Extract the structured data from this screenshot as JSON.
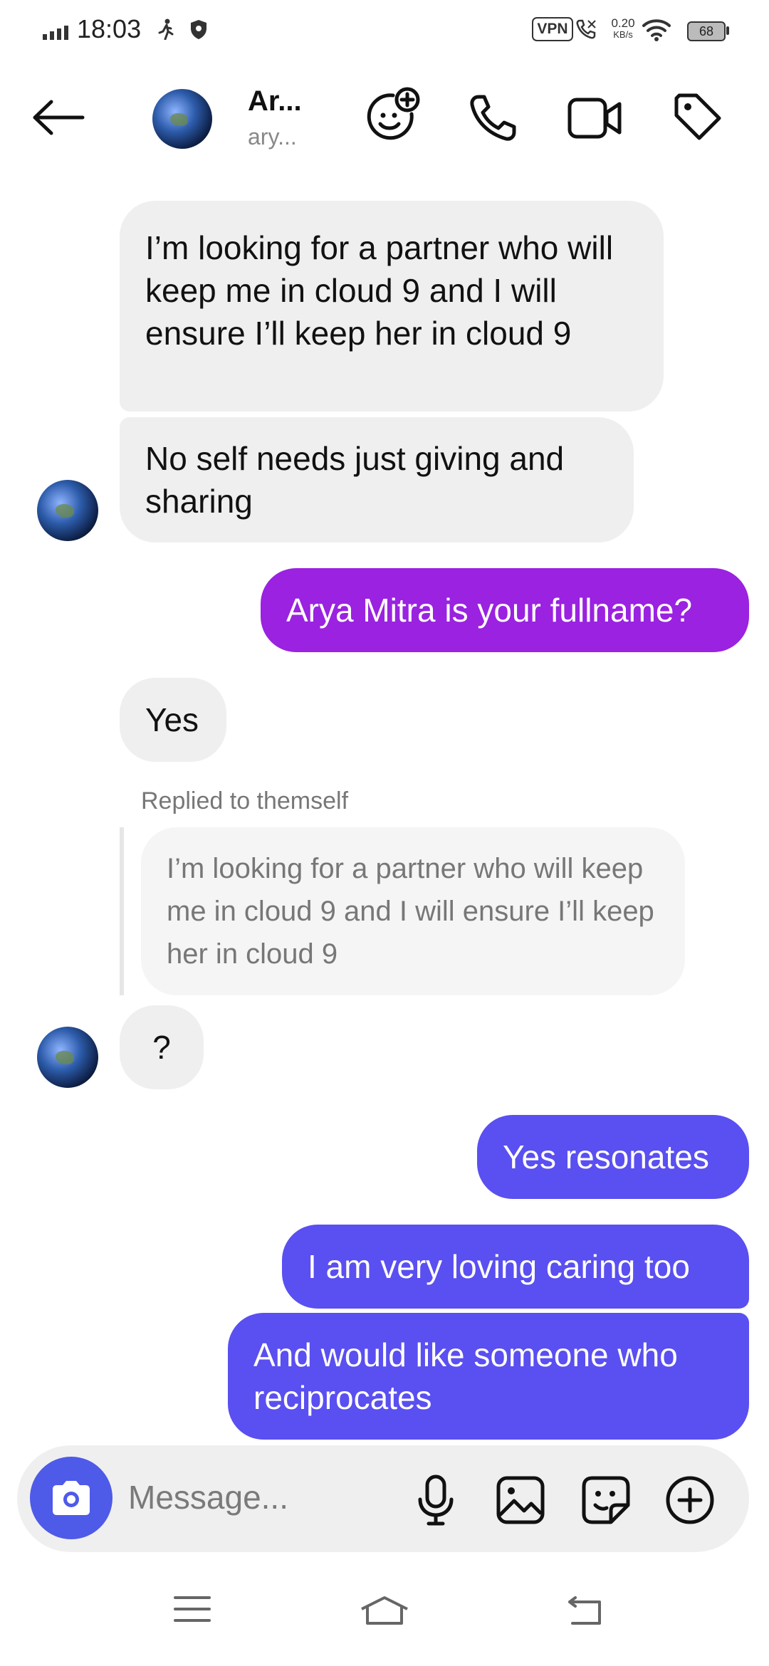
{
  "status_bar": {
    "time": "18:03",
    "vpn": "VPN",
    "net_speed_value": "0.20",
    "net_speed_unit": "KB/s",
    "battery": "68"
  },
  "header": {
    "name": "Ar...",
    "username": "ary..."
  },
  "messages": [
    {
      "id": "m1",
      "direction": "incoming",
      "text": "I’m looking for a partner who will keep me in cloud 9 and I will ensure I’ll keep her in cloud 9"
    },
    {
      "id": "m2",
      "direction": "incoming",
      "text": "No self needs just giving and sharing"
    },
    {
      "id": "m3",
      "direction": "outgoing",
      "text": "Arya Mitra is your fullname?"
    },
    {
      "id": "m4",
      "direction": "incoming",
      "text": "Yes"
    },
    {
      "id": "m5",
      "direction": "incoming",
      "reply_label": "Replied to themself",
      "quoted": "I’m looking for a partner who will keep me in cloud 9 and I will ensure I’ll keep her in cloud 9",
      "text": "?"
    },
    {
      "id": "m6",
      "direction": "outgoing",
      "text": "Yes resonates"
    },
    {
      "id": "m7",
      "direction": "outgoing",
      "text": "I am very loving caring too"
    },
    {
      "id": "m8",
      "direction": "outgoing",
      "text": "And would like someone who reciprocates"
    }
  ],
  "composer": {
    "placeholder": "Message..."
  },
  "colors": {
    "outgoing_purple": "#9a22e0",
    "outgoing_blue": "#5a4ff0",
    "incoming_bg": "#efefef",
    "camera_button": "#4e5ae8"
  },
  "icons": [
    "signal-icon",
    "walk-icon",
    "shield-icon",
    "call-status-icon",
    "wifi-icon",
    "back-arrow-icon",
    "add-effect-icon",
    "phone-icon",
    "video-icon",
    "tag-icon",
    "camera-icon",
    "mic-icon",
    "gallery-icon",
    "sticker-icon",
    "plus-icon",
    "menu-nav-icon",
    "home-nav-icon",
    "back-nav-icon"
  ]
}
